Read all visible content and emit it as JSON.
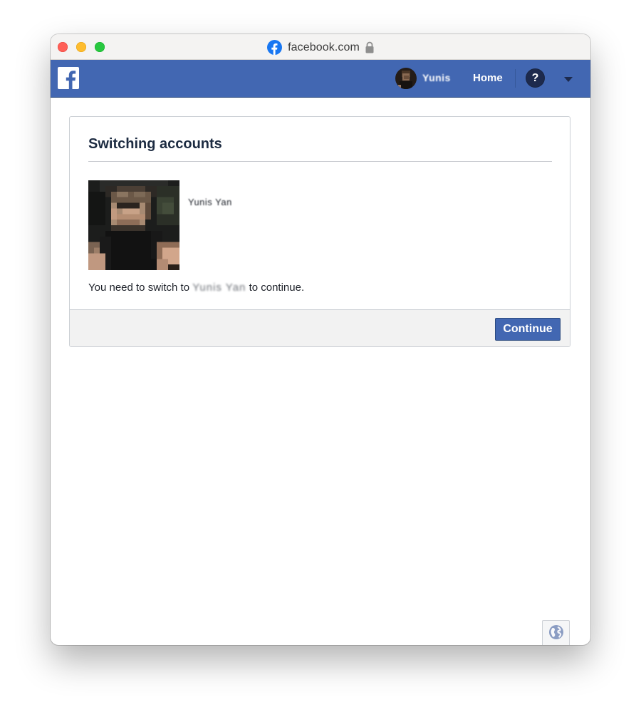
{
  "browser": {
    "url": "facebook.com"
  },
  "header": {
    "user_name": "Yunis",
    "home_label": "Home",
    "help_label": "?"
  },
  "dialog": {
    "title": "Switching accounts",
    "profile_name": "Yunis Yan",
    "message_prefix": "You need to switch to",
    "message_name": "Yunis Yan",
    "message_suffix": "to continue.",
    "continue_label": "Continue"
  },
  "colors": {
    "facebook_blue": "#4267b2",
    "page_background": "#ffffff",
    "footer_gray": "#f2f2f2"
  },
  "icons": {
    "site_icon": "facebook-icon",
    "lock": "lock-icon",
    "logo": "facebook-f-logo-icon",
    "help": "help-icon",
    "dropdown": "caret-down-icon",
    "language": "globe-icon"
  }
}
